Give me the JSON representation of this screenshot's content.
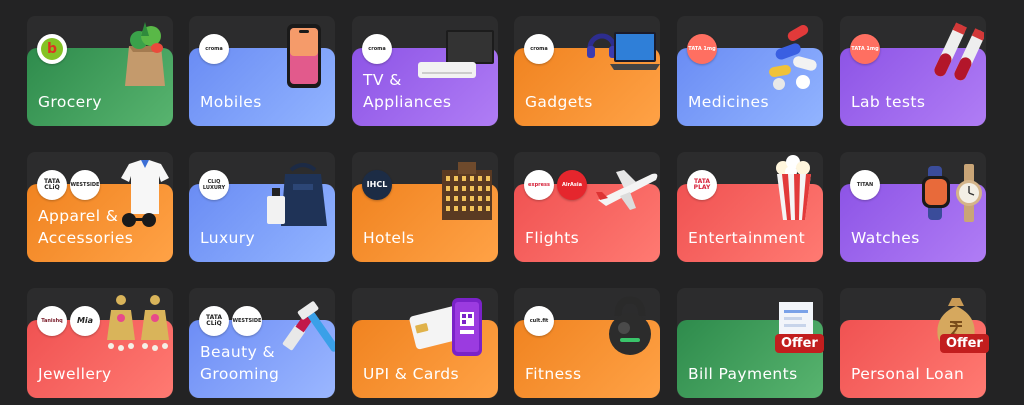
{
  "tiles": [
    {
      "id": "grocery",
      "label": "Grocery",
      "logos": [
        "bb"
      ]
    },
    {
      "id": "mobiles",
      "label": "Mobiles",
      "logos": [
        "croma"
      ]
    },
    {
      "id": "tv",
      "label": "TV &\nAppliances",
      "logos": [
        "croma"
      ]
    },
    {
      "id": "gadgets",
      "label": "Gadgets",
      "logos": [
        "croma"
      ]
    },
    {
      "id": "medicines",
      "label": "Medicines",
      "logos": [
        "TATA 1mg"
      ]
    },
    {
      "id": "labtests",
      "label": "Lab tests",
      "logos": [
        "TATA 1mg"
      ]
    },
    {
      "id": "apparel",
      "label": "Apparel &\nAccessories",
      "logos": [
        "TATA CLiQ",
        "WESTSIDE"
      ]
    },
    {
      "id": "luxury",
      "label": "Luxury",
      "logos": [
        "CLiQ LUXURY"
      ]
    },
    {
      "id": "hotels",
      "label": "Hotels",
      "logos": [
        "IHCL"
      ]
    },
    {
      "id": "flights",
      "label": "Flights",
      "logos": [
        "express",
        "AirAsia"
      ]
    },
    {
      "id": "entertainment",
      "label": "Entertainment",
      "logos": [
        "TATA PLAY"
      ]
    },
    {
      "id": "watches",
      "label": "Watches",
      "logos": [
        "TITAN"
      ]
    },
    {
      "id": "jewellery",
      "label": "Jewellery",
      "logos": [
        "Tanishq",
        "Mia"
      ]
    },
    {
      "id": "beauty",
      "label": "Beauty &\nGrooming",
      "logos": [
        "TATA CLiQ",
        "WESTSIDE"
      ]
    },
    {
      "id": "upi",
      "label": "UPI & Cards",
      "logos": []
    },
    {
      "id": "fitness",
      "label": "Fitness",
      "logos": [
        "cult.fit"
      ]
    },
    {
      "id": "bills",
      "label": "Bill Payments",
      "logos": [],
      "badge": "Offer"
    },
    {
      "id": "loan",
      "label": "Personal Loan",
      "logos": [],
      "badge": "Offer"
    }
  ],
  "colors": {
    "page_bg": "#232324",
    "tile_bg": "#2c2c2d",
    "green": "#2e8b4c",
    "blue": "#6a8cf4",
    "purple": "#8d54e6",
    "orange": "#f08320",
    "red": "#f05252",
    "offer_badge": "#c21e1e"
  }
}
